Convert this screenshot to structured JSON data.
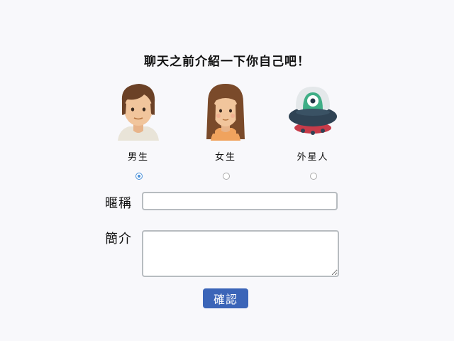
{
  "title": "聊天之前介紹一下你自己吧！",
  "avatars": [
    {
      "label": "男生",
      "icon": "male-avatar-icon",
      "selected": true
    },
    {
      "label": "女生",
      "icon": "female-avatar-icon",
      "selected": false
    },
    {
      "label": "外星人",
      "icon": "alien-ufo-icon",
      "selected": false
    }
  ],
  "form": {
    "nickname_label": "暱稱",
    "nickname_value": "",
    "bio_label": "簡介",
    "bio_value": "",
    "confirm_label": "確認"
  },
  "colors": {
    "accent": "#3b65b8",
    "radio_selected": "#4a90d9"
  }
}
